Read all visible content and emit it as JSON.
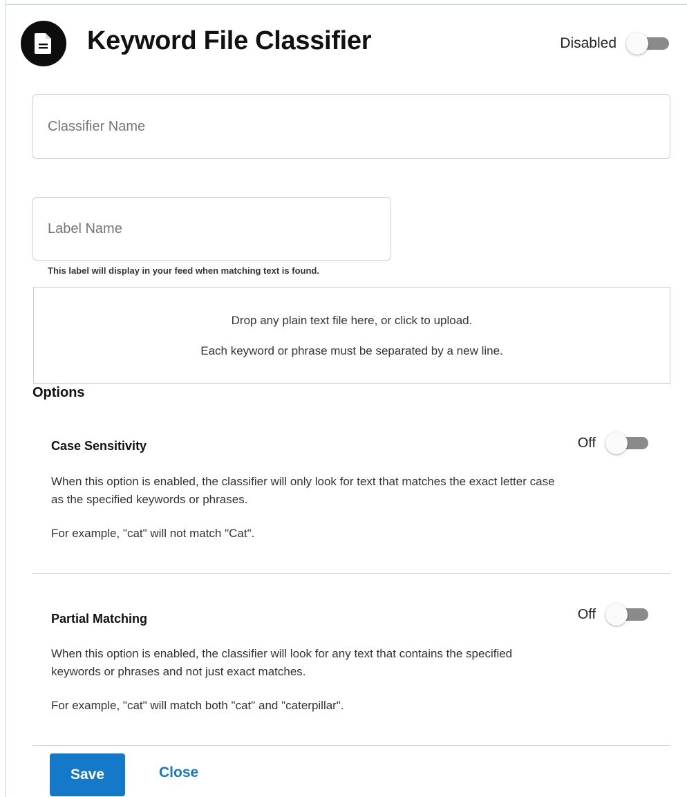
{
  "header": {
    "title": "Keyword File Classifier",
    "icon": "document-icon",
    "status_label": "Disabled",
    "enabled": false
  },
  "form": {
    "classifier_name": {
      "value": "",
      "placeholder": "Classifier Name"
    },
    "label_name": {
      "value": "",
      "placeholder": "Label Name"
    },
    "label_helper": "This label will display in your feed when matching text is found."
  },
  "dropzone": {
    "line1": "Drop any plain text file here, or click to upload.",
    "line2": "Each keyword or phrase must be separated by a new line."
  },
  "options": {
    "heading": "Options",
    "items": [
      {
        "title": "Case Sensitivity",
        "state_label": "Off",
        "enabled": false,
        "description": "When this option is enabled, the classifier will only look for text that matches the exact letter case as the specified keywords or phrases.",
        "example": "For example, \"cat\" will not match \"Cat\"."
      },
      {
        "title": "Partial Matching",
        "state_label": "Off",
        "enabled": false,
        "description": "When this option is enabled, the classifier will look for any text that contains the specified keywords or phrases and not just exact matches.",
        "example": "For example, \"cat\" will match both \"cat\" and \"caterpillar\"."
      }
    ]
  },
  "footer": {
    "save_label": "Save",
    "close_label": "Close"
  },
  "colors": {
    "accent": "#1479c9",
    "toggle_track_off": "#8a8a8a",
    "icon_background": "#0d0d0d"
  }
}
